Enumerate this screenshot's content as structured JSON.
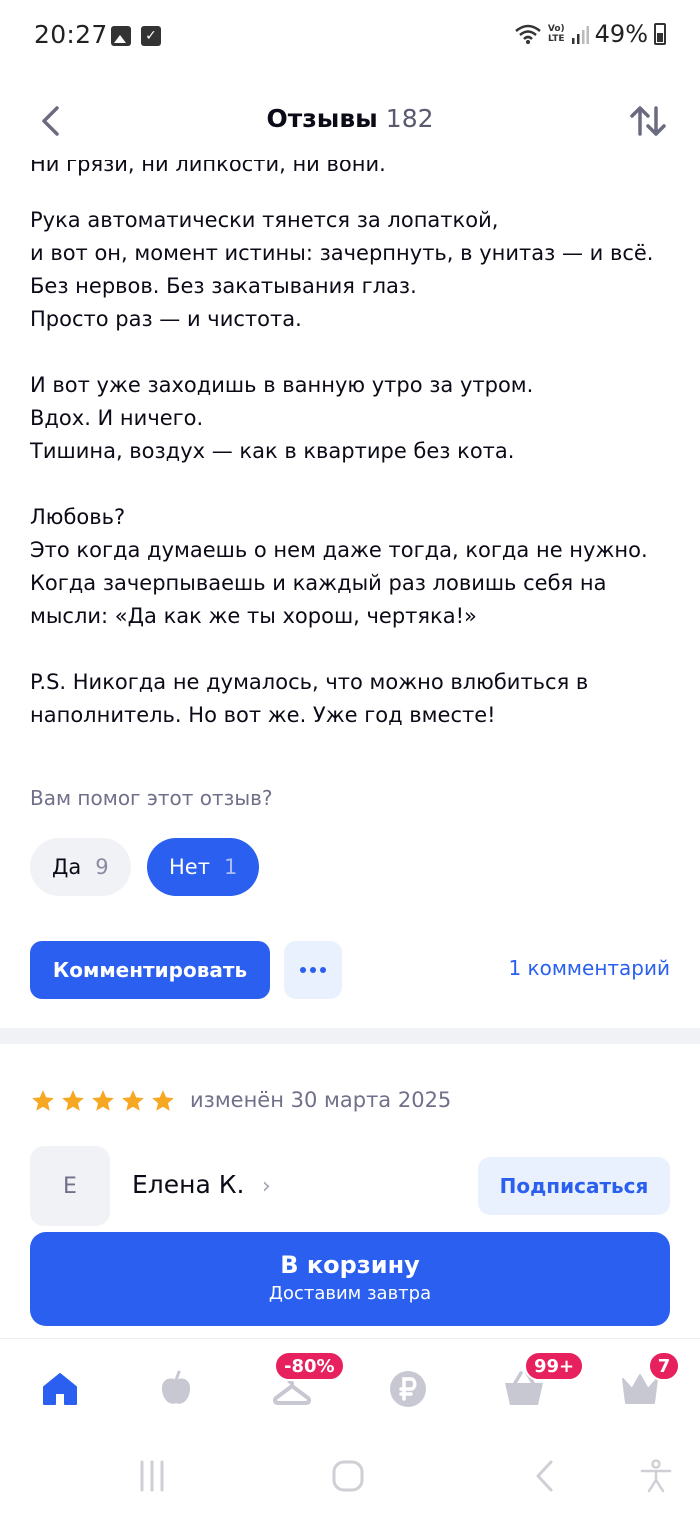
{
  "status_bar": {
    "time": "20:27",
    "battery": "49%",
    "network": "Vo) LTE"
  },
  "header": {
    "title": "Отзывы",
    "count": "182"
  },
  "review": {
    "clipped_line": "Ни грязи, ни липкости, ни вони.",
    "paragraphs": [
      [
        "Рука автоматически тянется за лопаткой,",
        "и вот он, момент истины: зачерпнуть, в унитаз — и всё.",
        "Без нервов. Без закатывания глаз.",
        "Просто раз — и чистота."
      ],
      [
        "И вот уже заходишь в ванную утро за утром.",
        "Вдох. И ничего.",
        "Тишина, воздух — как в квартире без кота."
      ],
      [
        "Любовь?",
        "Это когда думаешь о нем даже тогда, когда не нужно.",
        "Когда зачерпываешь и каждый раз ловишь себя на",
        "мысли: «Да как же ты хорош, чертяка!»"
      ],
      [
        "P.S. Никогда не думалось, что можно влюбиться в",
        "наполнитель. Но вот же. Уже год вместе!"
      ]
    ],
    "helpful_question": "Вам помог этот отзыв?",
    "vote_yes_label": "Да",
    "vote_yes_count": "9",
    "vote_no_label": "Нет",
    "vote_no_count": "1",
    "comment_button": "Комментировать",
    "comments_link": "1 комментарий"
  },
  "next_review": {
    "rating": 5,
    "edited": "изменён 30 марта 2025",
    "avatar_letter": "Е",
    "author": "Елена К.",
    "subscribe_button": "Подписаться"
  },
  "cart": {
    "title": "В корзину",
    "subtitle": "Доставим завтра"
  },
  "bottom_nav": {
    "items": [
      {
        "icon": "home-icon"
      },
      {
        "icon": "apple-icon"
      },
      {
        "icon": "hanger-icon",
        "badge": "-80%"
      },
      {
        "icon": "ruble-icon"
      },
      {
        "icon": "basket-icon",
        "badge": "99+"
      },
      {
        "icon": "crown-icon",
        "badge": "7"
      }
    ]
  },
  "colors": {
    "accent": "#2a5ff0",
    "badge": "#e6215e",
    "star": "#f7a823",
    "muted": "#70708a"
  }
}
